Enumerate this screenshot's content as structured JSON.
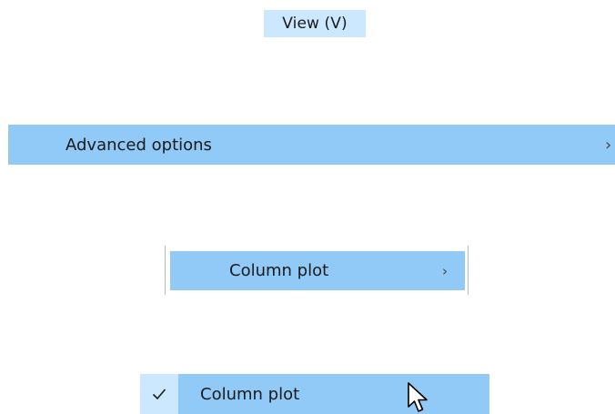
{
  "menubar": {
    "view_label": "View (V)"
  },
  "menu": {
    "advanced_options_label": "Advanced options",
    "advanced_options_chevron": "›"
  },
  "submenu": {
    "column_plot_label": "Column plot",
    "column_plot_chevron": "›"
  },
  "checked_item": {
    "column_plot_label": "Column plot",
    "checked": true
  },
  "colors": {
    "hover_highlight": "#91c9f7",
    "light_highlight": "#cce8ff"
  },
  "icons": {
    "check": "checkmark-icon",
    "cursor": "mouse-pointer-icon"
  }
}
